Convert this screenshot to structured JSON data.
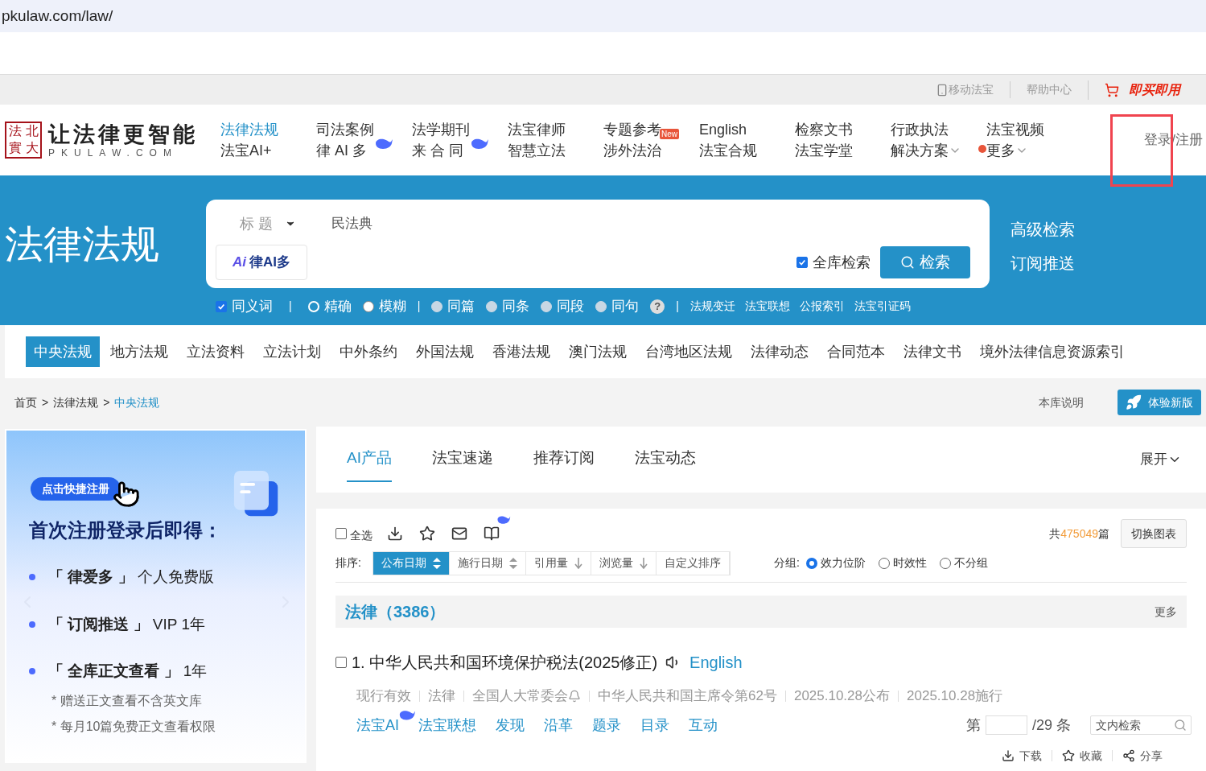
{
  "address_bar": {
    "url": "pkulaw.com/law/"
  },
  "utility_bar": {
    "items": [
      {
        "kind": "mobile",
        "label": "移动法宝"
      },
      {
        "kind": "help",
        "label": "帮助中心"
      },
      {
        "kind": "buy",
        "label": "即买即用"
      }
    ]
  },
  "header": {
    "logo": {
      "seal": [
        "法",
        "北",
        "實",
        "大"
      ],
      "slogan": "让法律更智能",
      "domain": "PKULAW.COM"
    },
    "nav": [
      {
        "top": "法律法规",
        "bottom": "法宝AI+",
        "selected": true,
        "whale": false,
        "dropdown": false,
        "dot": false
      },
      {
        "top": "司法案例",
        "bottom": "律 AI 多",
        "selected": false,
        "whale": true,
        "dropdown": false,
        "dot": false
      },
      {
        "top": "法学期刊",
        "bottom": "来 合 同",
        "selected": false,
        "whale": true,
        "dropdown": false,
        "dot": false
      },
      {
        "top": "法宝律师",
        "bottom": "智慧立法",
        "selected": false,
        "whale": false,
        "dropdown": false,
        "dot": false
      },
      {
        "top": "专题参考",
        "bottom": "涉外法治",
        "selected": false,
        "whale": false,
        "badge": "New",
        "dropdown": false,
        "dot": false
      },
      {
        "top": "English",
        "bottom": "法宝合规",
        "selected": false,
        "whale": false,
        "dropdown": false,
        "dot": false
      },
      {
        "top": "检察文书",
        "bottom": "法宝学堂",
        "selected": false,
        "whale": false,
        "dropdown": false,
        "dot": false
      },
      {
        "top": "行政执法",
        "bottom": "解决方案",
        "selected": false,
        "whale": false,
        "dropdown": true,
        "dot": false
      },
      {
        "top": "法宝视频",
        "bottom": "更多",
        "selected": false,
        "whale": false,
        "dropdown": true,
        "dot": true
      }
    ],
    "login": "登录/注册",
    "highlight_box": true
  },
  "banner": {
    "title": "法律法规",
    "search": {
      "field": "标 题",
      "value": "民法典",
      "ai_logo": "Ai",
      "ai_label": "律AI多",
      "whole_library": {
        "label": "全库检索",
        "checked": true
      },
      "button": "检索"
    },
    "side_links": [
      "高级检索",
      "订阅推送"
    ],
    "options": {
      "synonym": {
        "label": "同义词",
        "checked": true
      },
      "modes": [
        {
          "label": "精确",
          "selected": true,
          "disabled": false
        },
        {
          "label": "模糊",
          "selected": false,
          "disabled": false
        },
        {
          "label": "同篇",
          "selected": false,
          "disabled": true
        },
        {
          "label": "同条",
          "selected": false,
          "disabled": true
        },
        {
          "label": "同段",
          "selected": false,
          "disabled": true
        },
        {
          "label": "同句",
          "selected": false,
          "disabled": true
        }
      ],
      "separator": "|",
      "help": "?",
      "links": [
        "法规变迁",
        "法宝联想",
        "公报索引",
        "法宝引证码"
      ]
    }
  },
  "categories": [
    {
      "label": "中央法规",
      "selected": true
    },
    {
      "label": "地方法规",
      "selected": false
    },
    {
      "label": "立法资料",
      "selected": false
    },
    {
      "label": "立法计划",
      "selected": false
    },
    {
      "label": "中外条约",
      "selected": false
    },
    {
      "label": "外国法规",
      "selected": false
    },
    {
      "label": "香港法规",
      "selected": false
    },
    {
      "label": "澳门法规",
      "selected": false
    },
    {
      "label": "台湾地区法规",
      "selected": false
    },
    {
      "label": "法律动态",
      "selected": false
    },
    {
      "label": "合同范本",
      "selected": false
    },
    {
      "label": "法律文书",
      "selected": false
    },
    {
      "label": "境外法律信息资源索引",
      "selected": false
    }
  ],
  "breadcrumb": {
    "items": [
      "首页",
      "法律法规",
      "中央法规"
    ],
    "separator": ">",
    "info": "本库说明",
    "new_version": "体验新版"
  },
  "promo": {
    "pill": "点击快捷注册",
    "heading": "首次注册登录后即得：",
    "benefits": [
      "**「 律爱多 」** 个人免费版",
      "**「 订阅推送 」** VIP 1年",
      "**「 全库正文查看 」** 1年"
    ],
    "notes": [
      "* 赠送正文查看不含英文库",
      "* 每月10篇免费正文查看权限"
    ]
  },
  "panel_tabs": {
    "tabs": [
      {
        "label": "AI产品",
        "selected": true
      },
      {
        "label": "法宝速递",
        "selected": false
      },
      {
        "label": "推荐订阅",
        "selected": false
      },
      {
        "label": "法宝动态",
        "selected": false
      }
    ],
    "expand": "展开"
  },
  "results": {
    "select_all": {
      "label": "全选",
      "checked": false
    },
    "total": {
      "prefix": "共",
      "count": "475049",
      "suffix": "篇"
    },
    "switch": "切换图表",
    "sort_label": "排序:",
    "sort": [
      {
        "label": "公布日期",
        "selected": true,
        "kind": "both"
      },
      {
        "label": "施行日期",
        "selected": false,
        "kind": "both"
      },
      {
        "label": "引用量",
        "selected": false,
        "kind": "down"
      },
      {
        "label": "浏览量",
        "selected": false,
        "kind": "down"
      },
      {
        "label": "自定义排序",
        "selected": false,
        "kind": "none"
      }
    ],
    "group_label": "分组:",
    "groups": [
      {
        "label": "效力位阶",
        "selected": true
      },
      {
        "label": "时效性",
        "selected": false
      },
      {
        "label": "不分组",
        "selected": false
      }
    ],
    "section": {
      "title": "法律（3386）",
      "more": "更多"
    },
    "item": {
      "checked": false,
      "number": "1.",
      "title": "中华人民共和国环境保护税法(2025修正)",
      "english": "English",
      "meta": [
        {
          "text": "现行有效",
          "kind": "plain"
        },
        {
          "text": "法律",
          "kind": "plain"
        },
        {
          "text": "全国人大常委会",
          "kind": "subscribe"
        },
        {
          "text": "中华人民共和国主席令第62号",
          "kind": "plain"
        },
        {
          "text": "2025.10.28公布",
          "kind": "plain"
        },
        {
          "text": "2025.10.28施行",
          "kind": "plain"
        }
      ],
      "actions": [
        {
          "label": "法宝AI",
          "kind": "ai"
        },
        {
          "label": "法宝联想",
          "kind": "plain"
        },
        {
          "label": "发现",
          "kind": "plain"
        },
        {
          "label": "沿革",
          "kind": "plain"
        },
        {
          "label": "题录",
          "kind": "plain"
        },
        {
          "label": "目录",
          "kind": "plain"
        },
        {
          "label": "互动",
          "kind": "plain"
        }
      ],
      "pager": {
        "prefix": "第",
        "total": "/29 条"
      },
      "search_placeholder": "文内检索",
      "footer": [
        {
          "kind": "download",
          "label": "下载"
        },
        {
          "kind": "favorite",
          "label": "收藏"
        },
        {
          "kind": "share",
          "label": "分享"
        }
      ]
    }
  }
}
